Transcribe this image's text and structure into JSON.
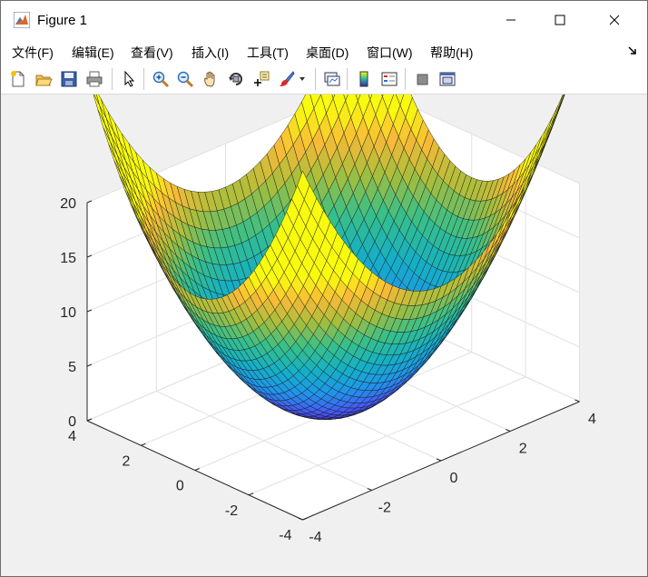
{
  "window": {
    "title": "Figure 1",
    "controls": [
      "minimize",
      "maximize",
      "close"
    ]
  },
  "menu": {
    "items": [
      "文件(F)",
      "编辑(E)",
      "查看(V)",
      "插入(I)",
      "工具(T)",
      "桌面(D)",
      "窗口(W)",
      "帮助(H)"
    ]
  },
  "toolbar": {
    "buttons": [
      "new-figure-icon",
      "open-file-icon",
      "save-icon",
      "print-icon",
      "pointer-icon",
      "zoom-in-icon",
      "zoom-out-icon",
      "pan-hand-icon",
      "rotate-3d-icon",
      "data-cursor-icon",
      "brush-icon",
      "link-plot-icon",
      "colorbar-icon",
      "legend-icon",
      "hide-plot-tools-icon",
      "show-plot-tools-icon"
    ]
  },
  "chart_data": {
    "type": "surface",
    "function": "z = x^2 + y^2",
    "x_range": [
      -4,
      4
    ],
    "y_range": [
      -4,
      4
    ],
    "z_range": [
      0,
      20
    ],
    "colormap": "parula",
    "grid": true,
    "x_ticks": [
      "-4",
      "-2",
      "0",
      "2",
      "4"
    ],
    "y_ticks": [
      "4",
      "2",
      "0",
      "-2",
      "-4"
    ],
    "z_ticks": [
      "0",
      "5",
      "10",
      "15",
      "20"
    ]
  }
}
